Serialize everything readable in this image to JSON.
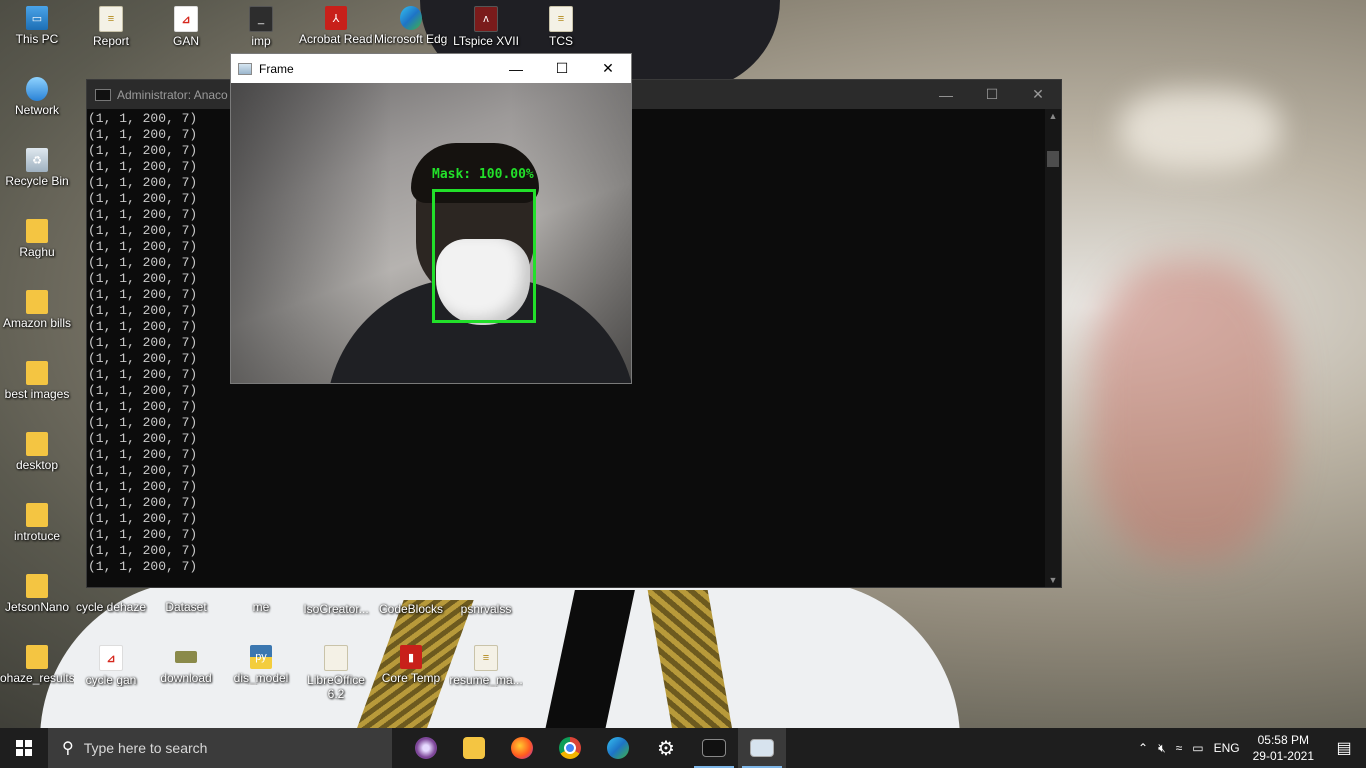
{
  "desktop": {
    "icons": [
      {
        "label": "This PC",
        "icon": "this-pc-icon"
      },
      {
        "label": "Report",
        "icon": "document-icon"
      },
      {
        "label": "GAN",
        "icon": "pdf-icon"
      },
      {
        "label": "imp",
        "icon": "terminal-icon"
      },
      {
        "label": "Acrobat Reader DC",
        "icon": "acrobat-icon"
      },
      {
        "label": "Microsoft Edge",
        "icon": "edge-icon"
      },
      {
        "label": "LTspice XVII",
        "icon": "ltspice-icon"
      },
      {
        "label": "TCS",
        "icon": "document-icon"
      },
      {
        "label": "Network",
        "icon": "network-icon"
      },
      {
        "label": "Recycle Bin",
        "icon": "recycle-bin-icon"
      },
      {
        "label": "Raghu",
        "icon": "folder-icon"
      },
      {
        "label": "Amazon bills",
        "icon": "folder-icon"
      },
      {
        "label": "best images",
        "icon": "folder-icon"
      },
      {
        "label": "desktop",
        "icon": "folder-icon"
      },
      {
        "label": "introtuce",
        "icon": "folder-icon"
      },
      {
        "label": "JetsonNano",
        "icon": "folder-icon"
      },
      {
        "label": "cycle dehaze",
        "icon": "folder-icon"
      },
      {
        "label": "Dataset",
        "icon": "folder-icon"
      },
      {
        "label": "me",
        "icon": "folder-icon"
      },
      {
        "label": "IsoCreator...",
        "icon": "app-icon"
      },
      {
        "label": "CodeBlocks",
        "icon": "codeblocks-icon"
      },
      {
        "label": "psnrvalss",
        "icon": "document-icon"
      },
      {
        "label": "ohaze_results",
        "icon": "folder-icon"
      },
      {
        "label": "cycle gan",
        "icon": "pdf-icon"
      },
      {
        "label": "download",
        "icon": "image-icon"
      },
      {
        "label": "dis_model",
        "icon": "python-icon"
      },
      {
        "label": "LibreOffice 6.2",
        "icon": "libreoffice-icon"
      },
      {
        "label": "Core Temp",
        "icon": "coretemp-icon"
      },
      {
        "label": "resume_ma...",
        "icon": "document-icon"
      }
    ]
  },
  "console": {
    "title": "Administrator: Anaco",
    "lines": [
      "(1, 1, 200, 7)",
      "(1, 1, 200, 7)",
      "(1, 1, 200, 7)",
      "(1, 1, 200, 7)",
      "(1, 1, 200, 7)",
      "(1, 1, 200, 7)",
      "(1, 1, 200, 7)",
      "(1, 1, 200, 7)",
      "(1, 1, 200, 7)",
      "(1, 1, 200, 7)",
      "(1, 1, 200, 7)",
      "(1, 1, 200, 7)",
      "(1, 1, 200, 7)",
      "(1, 1, 200, 7)",
      "(1, 1, 200, 7)",
      "(1, 1, 200, 7)",
      "(1, 1, 200, 7)",
      "(1, 1, 200, 7)",
      "(1, 1, 200, 7)",
      "(1, 1, 200, 7)",
      "(1, 1, 200, 7)",
      "(1, 1, 200, 7)",
      "(1, 1, 200, 7)",
      "(1, 1, 200, 7)",
      "(1, 1, 200, 7)",
      "(1, 1, 200, 7)",
      "(1, 1, 200, 7)",
      "(1, 1, 200, 7)",
      "(1, 1, 200, 7)"
    ]
  },
  "frame": {
    "title": "Frame",
    "detection_label": "Mask: 100.00%"
  },
  "taskbar": {
    "search_placeholder": "Type here to search",
    "apps": [
      {
        "name": "tor-browser",
        "icon": "tor-icon",
        "state": "pinned"
      },
      {
        "name": "file-explorer",
        "icon": "folder-icon",
        "state": "pinned"
      },
      {
        "name": "firefox",
        "icon": "firefox-icon",
        "state": "pinned"
      },
      {
        "name": "chrome",
        "icon": "chrome-icon",
        "state": "pinned"
      },
      {
        "name": "edge",
        "icon": "edge-icon",
        "state": "pinned"
      },
      {
        "name": "settings",
        "icon": "gear-icon",
        "state": "pinned"
      },
      {
        "name": "command-prompt",
        "icon": "terminal-icon",
        "state": "open"
      },
      {
        "name": "frame-window",
        "icon": "frame-window-icon",
        "state": "active"
      }
    ],
    "tray": {
      "language": "ENG",
      "time": "05:58 PM",
      "date": "29-01-2021"
    }
  },
  "colors": {
    "detection_box": "#22e02a",
    "console_bg": "#0c0c0c",
    "taskbar_bg": "#1e1e1e"
  }
}
